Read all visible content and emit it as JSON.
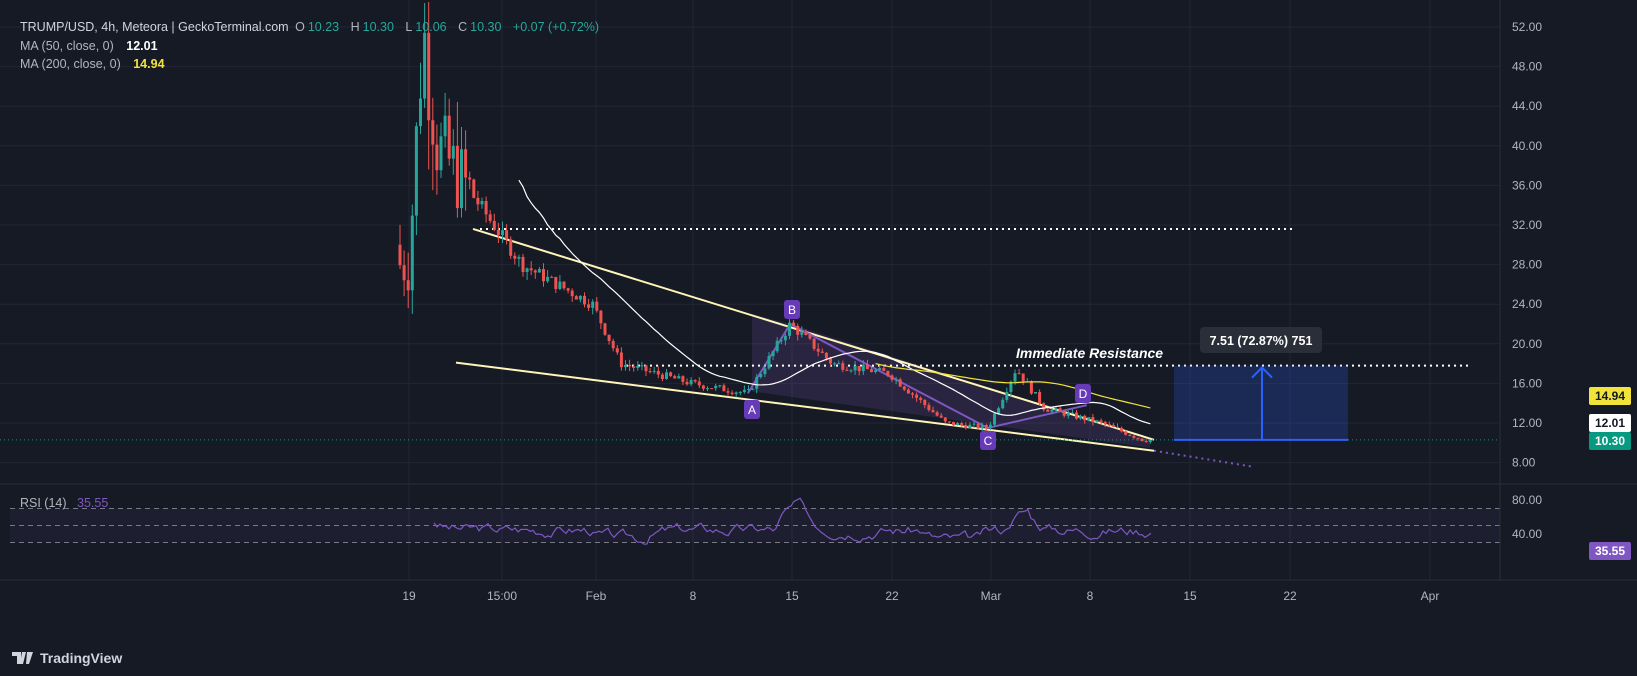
{
  "header": {
    "symbol": "TRUMP/USD, 4h, Meteora | GeckoTerminal.com",
    "o_label": "O",
    "o_val": "10.23",
    "h_label": "H",
    "h_val": "10.30",
    "l_label": "L",
    "l_val": "10.06",
    "c_label": "C",
    "c_val": "10.30",
    "change": "+0.07 (+0.72%)",
    "ma50_label": "MA (50, close, 0)",
    "ma50_val": "12.01",
    "ma200_label": "MA (200, close, 0)",
    "ma200_val": "14.94",
    "rsi_label": "RSI (14)",
    "rsi_val": "35.55"
  },
  "price_labels": {
    "ma200": "14.94",
    "ma50": "12.01",
    "last": "10.30",
    "rsi": "35.55"
  },
  "annotations": {
    "resistance": "Immediate Resistance",
    "measure": "7.51 (72.87%) 751",
    "points": [
      "A",
      "B",
      "C",
      "D"
    ]
  },
  "branding": {
    "logo_text": "TradingView"
  },
  "colors": {
    "bg": "#161a25",
    "up": "#26a69a",
    "down": "#ef5350",
    "ma50": "#ffffff",
    "ma200": "#f2e33b",
    "rsi": "#7e57c2",
    "measure": "#2962ff",
    "trend": "#fff5b8"
  },
  "chart_data": [
    {
      "type": "candlestick",
      "title": "TRUMP/USD, 4h, Meteora | GeckoTerminal.com",
      "ylim": [
        6,
        54
      ],
      "y_ticks": [
        "52.00",
        "48.00",
        "44.00",
        "40.00",
        "36.00",
        "32.00",
        "28.00",
        "24.00",
        "20.00",
        "16.00",
        "12.00",
        "8.00"
      ],
      "x_ticks": [
        "19",
        "15:00",
        "Feb",
        "8",
        "15",
        "22",
        "Mar",
        "8",
        "15",
        "22",
        "Apr"
      ],
      "ohlc_anchors": [
        {
          "x": "Jan 19",
          "close": 28
        },
        {
          "x": "Jan 20",
          "close": 52
        },
        {
          "x": "Jan 21",
          "close": 40
        },
        {
          "x": "Jan 23",
          "close": 36
        },
        {
          "x": "Jan 27",
          "close": 28
        },
        {
          "x": "Feb 1",
          "close": 24
        },
        {
          "x": "Feb 3",
          "close": 18
        },
        {
          "x": "Feb 8",
          "close": 16
        },
        {
          "x": "Feb 12",
          "close": 15
        },
        {
          "x": "Feb 15",
          "close": 22
        },
        {
          "x": "Feb 18",
          "close": 18
        },
        {
          "x": "Feb 22",
          "close": 17
        },
        {
          "x": "Feb 26",
          "close": 12
        },
        {
          "x": "Mar 1",
          "close": 11.5
        },
        {
          "x": "Mar 3",
          "close": 17.5
        },
        {
          "x": "Mar 5",
          "close": 13.5
        },
        {
          "x": "Mar 9",
          "close": 12
        },
        {
          "x": "Mar 12",
          "close": 10.3
        }
      ],
      "last": {
        "open": 10.23,
        "high": 10.3,
        "low": 10.06,
        "close": 10.3,
        "change": 0.07,
        "change_pct": 0.72
      },
      "series": [
        {
          "name": "MA (50, close, 0)",
          "last": 12.01
        },
        {
          "name": "MA (200, close, 0)",
          "last": 14.94
        }
      ],
      "levels": [
        {
          "price": 31.6
        },
        {
          "price": 17.8,
          "label": "Immediate Resistance"
        }
      ],
      "measure": {
        "from": 10.3,
        "to": 17.8,
        "label": "7.51 (72.87%) 751"
      },
      "pattern_points": [
        {
          "name": "A",
          "x": "Feb 12",
          "price": 15.0
        },
        {
          "name": "B",
          "x": "Feb 15",
          "price": 22.0
        },
        {
          "name": "C",
          "x": "Mar 1",
          "price": 11.5
        },
        {
          "name": "D",
          "x": "Mar 8",
          "price": 13.8
        }
      ]
    },
    {
      "type": "line",
      "title": "RSI (14)",
      "ylim": [
        20,
        85
      ],
      "y_ticks": [
        "80.00",
        "40.00"
      ],
      "series": [
        {
          "name": "RSI (14)",
          "last": 35.55
        }
      ],
      "bands": [
        70,
        50,
        30
      ]
    }
  ]
}
